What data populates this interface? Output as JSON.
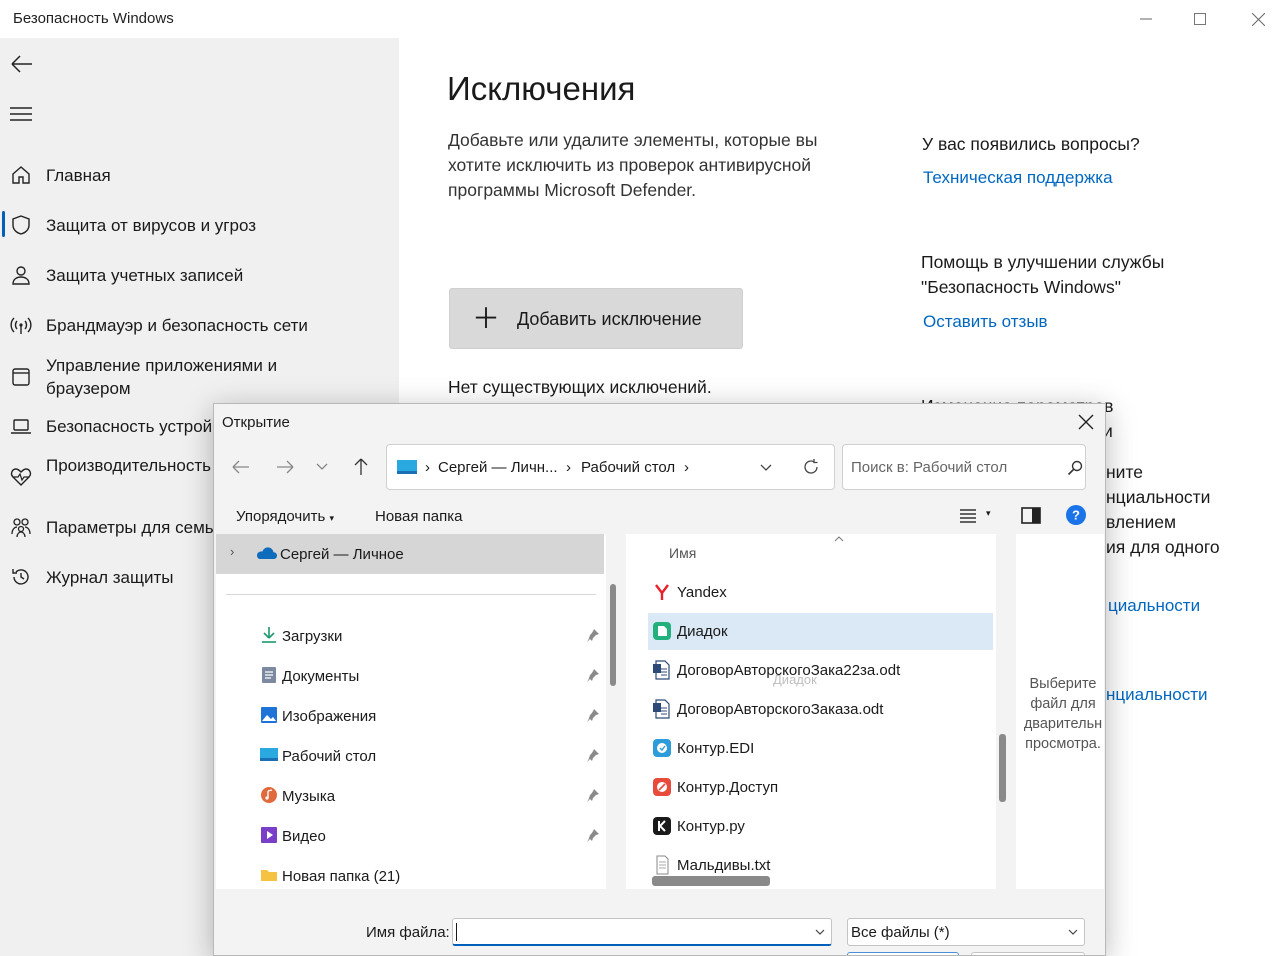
{
  "window": {
    "title": "Безопасность Windows",
    "minimize_icon": "minimize-icon",
    "maximize_icon": "maximize-icon",
    "close_icon": "close-icon"
  },
  "sidebar": {
    "items": [
      {
        "label": "Главная",
        "icon": "home-icon"
      },
      {
        "label": "Защита от вирусов и угроз",
        "icon": "shield-icon",
        "active": true
      },
      {
        "label": "Защита учетных записей",
        "icon": "person-icon"
      },
      {
        "label": "Брандмауэр и безопасность сети",
        "icon": "wifi-signal-icon"
      },
      {
        "label": "Управление приложениями и браузером",
        "icon": "app-window-icon"
      },
      {
        "label": "Безопасность устрой",
        "icon": "laptop-icon"
      },
      {
        "label": "Производительность работоспособность у",
        "icon": "heart-pulse-icon"
      },
      {
        "label": "Параметры для семь",
        "icon": "family-icon"
      },
      {
        "label": "Журнал защиты",
        "icon": "history-icon"
      }
    ],
    "accent": "#005fb8"
  },
  "main": {
    "title": "Исключения",
    "description": "Добавьте или удалите элементы, которые вы хотите исключить из проверок антивирусной программы Microsoft Defender.",
    "add_button": "Добавить исключение",
    "no_exclusions": "Нет существующих исключений."
  },
  "right_panel": {
    "questions_heading": "У вас появились вопросы?",
    "support_link": "Техническая поддержка",
    "improve_heading": "Помощь в улучшении службы \"Безопасность Windows\"",
    "feedback_link": "Оставить отзыв",
    "partial_heading": "Изменение параметров",
    "partial_lines": [
      "и",
      "ните",
      "нциальности",
      "влением",
      "ия для одного"
    ],
    "partial_link_1": "циальности",
    "partial_link_2": "нциальности",
    "link_color": "#0067c0"
  },
  "dialog": {
    "title": "Открытие",
    "breadcrumb": [
      "Сергей — Личн...",
      "Рабочий стол"
    ],
    "search_placeholder": "Поиск в: Рабочий стол",
    "organize": "Упорядочить",
    "new_folder": "Новая папка",
    "onedrive_item": "Сергей — Личное",
    "quick_access": [
      {
        "label": "Загрузки",
        "icon": "download-icon"
      },
      {
        "label": "Документы",
        "icon": "documents-icon"
      },
      {
        "label": "Изображения",
        "icon": "pictures-icon"
      },
      {
        "label": "Рабочий стол",
        "icon": "desktop-icon"
      },
      {
        "label": "Музыка",
        "icon": "music-icon"
      },
      {
        "label": "Видео",
        "icon": "video-icon"
      },
      {
        "label": "Новая папка (21)",
        "icon": "folder-icon"
      }
    ],
    "column_header": "Имя",
    "files": [
      {
        "label": "Yandex",
        "icon": "yandex-icon"
      },
      {
        "label": "Диадок",
        "icon": "diadoc-icon",
        "selected": true
      },
      {
        "label": "ДоговорАвторскогоЗака22за.odt",
        "icon": "odt-file-icon"
      },
      {
        "label": "ДоговорАвторскогоЗаказа.odt",
        "icon": "odt-file-icon"
      },
      {
        "label": "Контур.EDI",
        "icon": "kontur-edi-icon"
      },
      {
        "label": "Контур.Доступ",
        "icon": "kontur-access-icon"
      },
      {
        "label": "Контур.ру",
        "icon": "kontur-icon"
      },
      {
        "label": "Мальдивы.txt",
        "icon": "txt-file-icon"
      }
    ],
    "drag_ghost": "Диадок",
    "preview_text": "Выберите файл для дварительн просмотра.",
    "filename_label": "Имя файла:",
    "filename_value": "",
    "filetype": "Все файлы (*)"
  }
}
